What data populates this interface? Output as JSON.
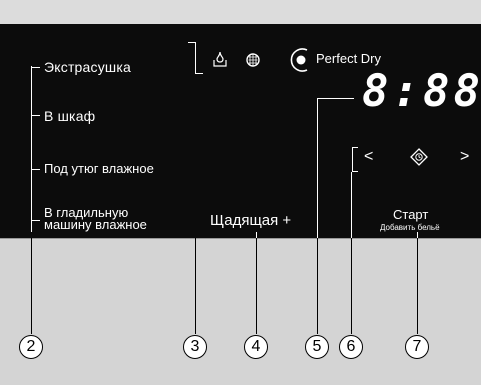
{
  "programs": [
    {
      "label": "Экстрасушка"
    },
    {
      "label": "В шкаф"
    },
    {
      "label": "Под утюг влажное"
    },
    {
      "label_line1": "В гладильную",
      "label_line2": "машину влажное"
    }
  ],
  "icons": [
    "water-drop-icon",
    "lint-filter-icon",
    "perfect-dry-icon"
  ],
  "perfect_dry": "Perfect Dry",
  "display": "8:88",
  "gentle": "Щадящая +",
  "start": "Старт",
  "add_laundry": "Добавить бельё",
  "nav": {
    "left": "<",
    "right": ">"
  },
  "callouts": [
    "2",
    "3",
    "4",
    "5",
    "6",
    "7"
  ]
}
